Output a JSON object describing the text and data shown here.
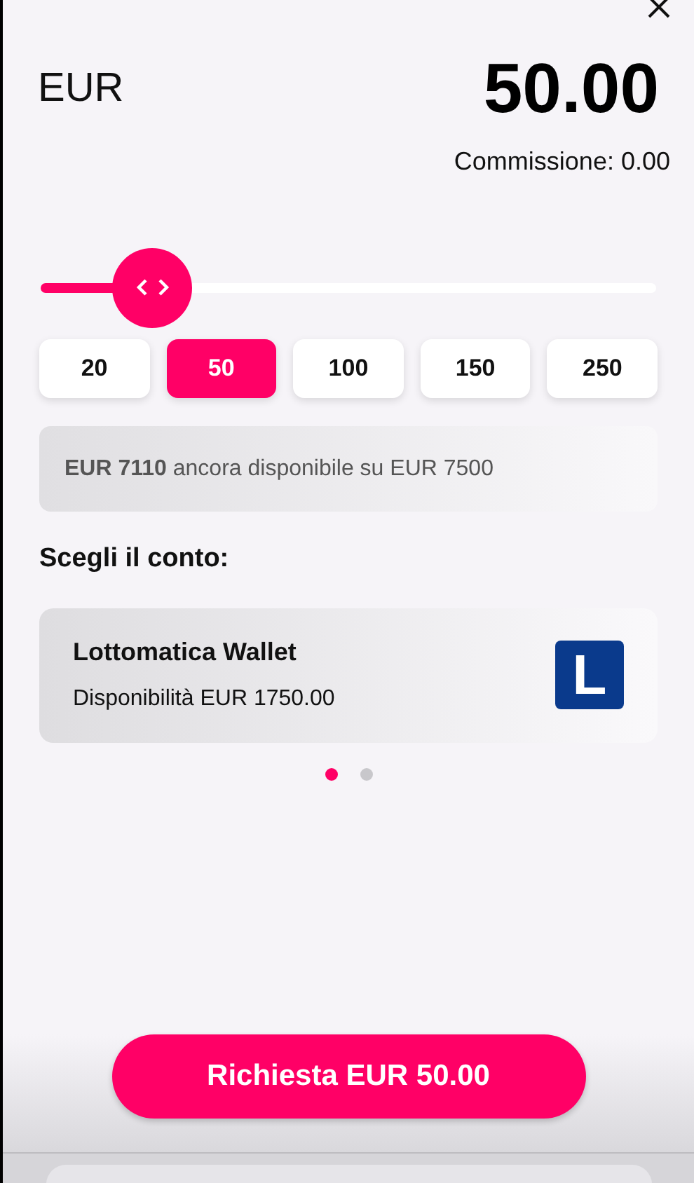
{
  "currency": "EUR",
  "amount": "50.00",
  "commission": "Commissione: 0.00",
  "slider": {
    "level": 0.18
  },
  "presets": [
    {
      "label": "20",
      "selected": false
    },
    {
      "label": "50",
      "selected": true
    },
    {
      "label": "100",
      "selected": false
    },
    {
      "label": "150",
      "selected": false
    },
    {
      "label": "250",
      "selected": false
    }
  ],
  "availability": "**EUR 7110** ancora disponibile su EUR 7500",
  "account_heading": "Scegli il conto:",
  "accounts": [
    {
      "name": "Lottomatica Wallet",
      "balance": "Disponibilità EUR 1750.00",
      "logo_letter": "L"
    }
  ],
  "pages": [
    {
      "selected": true
    },
    {
      "selected": false
    }
  ],
  "submit": "Richiesta EUR 50.00"
}
